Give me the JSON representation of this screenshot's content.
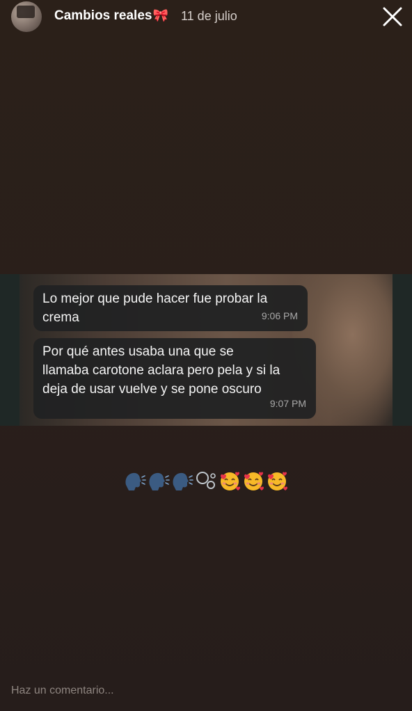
{
  "header": {
    "username": "Cambios reales",
    "username_emoji": "🎀",
    "date": "11 de julio",
    "avatar_icon": "profile-avatar",
    "close_icon": "close-icon"
  },
  "messages": [
    {
      "lines": [
        "Lo mejor que pude hacer fue probar la",
        "crema"
      ],
      "time": "9:06 PM"
    },
    {
      "lines": [
        "Por qué antes usaba una que se",
        "llamaba carotone aclara pero pela y si la",
        "deja de usar vuelve y se pone oscuro"
      ],
      "time": "9:07 PM"
    }
  ],
  "caption": {
    "text": "🗣🗣🗣°○°🥰🥰🥰",
    "emojis": [
      "speaking-head",
      "speaking-head",
      "speaking-head",
      "bubbles",
      "smiling-face-with-hearts",
      "smiling-face-with-hearts",
      "smiling-face-with-hearts"
    ]
  },
  "comment": {
    "placeholder": "Haz un comentario..."
  },
  "colors": {
    "background": "#2a1f1c",
    "bubble": "#202122",
    "bow": "#f29ab8",
    "muted_text": "#8e8580"
  }
}
